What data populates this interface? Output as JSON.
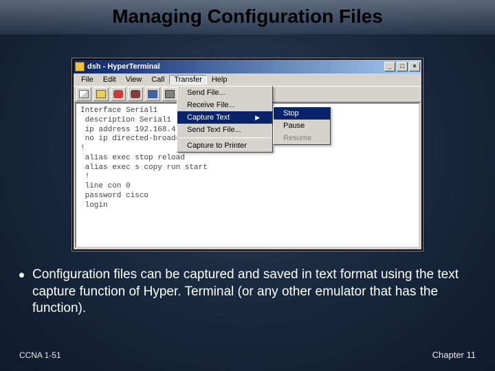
{
  "slide": {
    "title": "Managing Configuration Files",
    "bullet": "Configuration files can be captured and saved in text format using the text capture function of Hyper. Terminal (or any other emulator that has the function).",
    "footer_left": "CCNA 1-51",
    "footer_right": "Chapter 11"
  },
  "window": {
    "title": "dsh - HyperTerminal",
    "btn_min": "_",
    "btn_max": "□",
    "btn_close": "×",
    "menubar": [
      "File",
      "Edit",
      "View",
      "Call",
      "Transfer",
      "Help"
    ],
    "open_menu_index": 4,
    "transfer_menu": {
      "items": [
        {
          "label": "Send File...",
          "hl": false
        },
        {
          "label": "Receive File...",
          "hl": false
        },
        {
          "label": "Capture Text",
          "hl": true,
          "submenu": true
        },
        {
          "label": "Send Text File...",
          "hl": false
        }
      ],
      "sep_then": {
        "label": "Capture to Printer"
      }
    },
    "submenu": {
      "items": [
        {
          "label": "Stop",
          "hl": true
        },
        {
          "label": "Pause",
          "hl": false
        },
        {
          "label": "Resume",
          "hl": false,
          "disabled": true
        }
      ]
    },
    "terminal_text": "Interface Serial1\n description Serial1 Interface on the RTA router\n ip address 192.168.4.89.255.255.255.240\n no ip directed-broadcast\n!\n alias exec stop reload\n alias exec s copy run start\n !\n line con 0\n password cisco\n login"
  }
}
